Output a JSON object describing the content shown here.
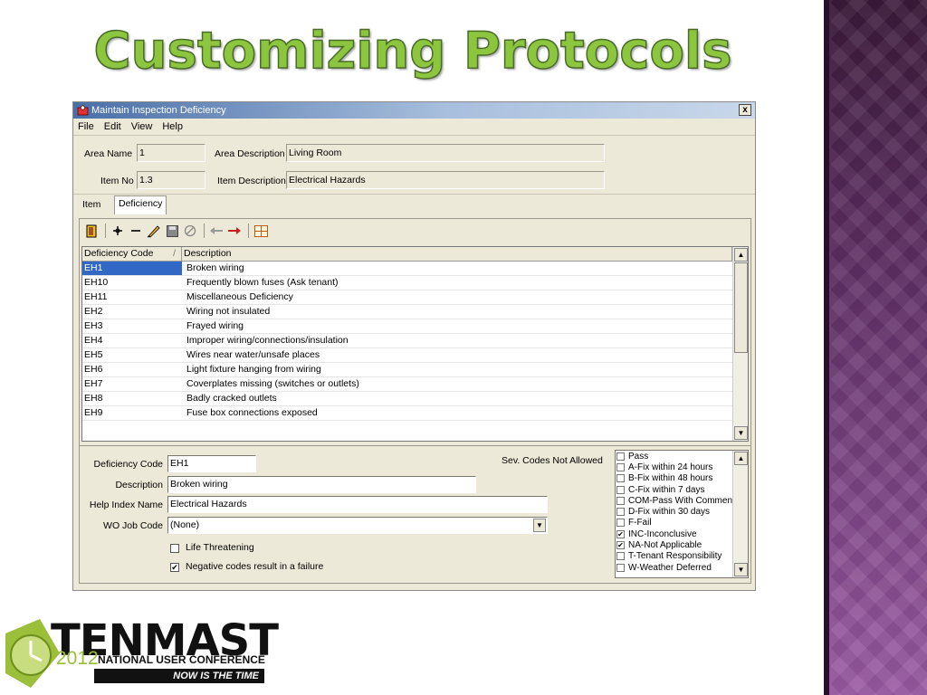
{
  "slide": {
    "title": "Customizing Protocols"
  },
  "window": {
    "title": "Maintain Inspection Deficiency",
    "close_label": "x",
    "menu": [
      "File",
      "Edit",
      "View",
      "Help"
    ]
  },
  "header": {
    "area_name_label": "Area Name",
    "area_name_value": "1",
    "area_description_label": "Area Description",
    "area_description_value": "Living Room",
    "item_no_label": "Item No",
    "item_no_value": "1.3",
    "item_description_label": "Item Description",
    "item_description_value": "Electrical Hazards"
  },
  "tabs": [
    "Item",
    "Deficiency"
  ],
  "active_tab": "Deficiency",
  "toolbar": {
    "icons": [
      "exit-door-icon",
      "add-icon",
      "remove-icon",
      "edit-pen-icon",
      "save-icon",
      "cancel-icon",
      "back-arrow-icon",
      "forward-arrow-icon",
      "grid-layout-icon"
    ]
  },
  "grid": {
    "columns": [
      "Deficiency Code",
      "Description"
    ],
    "sort_indicator": "/",
    "rows": [
      {
        "code": "EH1",
        "description": "Broken wiring"
      },
      {
        "code": "EH10",
        "description": "Frequently blown fuses (Ask tenant)"
      },
      {
        "code": "EH11",
        "description": "Miscellaneous Deficiency"
      },
      {
        "code": "EH2",
        "description": "Wiring not insulated"
      },
      {
        "code": "EH3",
        "description": "Frayed wiring"
      },
      {
        "code": "EH4",
        "description": "Improper wiring/connections/insulation"
      },
      {
        "code": "EH5",
        "description": "Wires near water/unsafe places"
      },
      {
        "code": "EH6",
        "description": "Light fixture hanging from wiring"
      },
      {
        "code": "EH7",
        "description": "Coverplates missing (switches or outlets)"
      },
      {
        "code": "EH8",
        "description": "Badly cracked outlets"
      },
      {
        "code": "EH9",
        "description": "Fuse box connections exposed"
      }
    ],
    "selected_index": 0
  },
  "detail": {
    "deficiency_code_label": "Deficiency Code",
    "deficiency_code_value": "EH1",
    "description_label": "Description",
    "description_value": "Broken wiring",
    "help_index_label": "Help Index Name",
    "help_index_value": "Electrical Hazards",
    "wo_job_code_label": "WO Job Code",
    "wo_job_code_value": "(None)",
    "life_threatening_label": "Life Threatening",
    "life_threatening_checked": false,
    "negative_codes_label": "Negative codes result in a failure",
    "negative_codes_checked": true,
    "sev_codes_label": "Sev. Codes Not Allowed",
    "sev_codes": [
      {
        "label": "Pass",
        "checked": false
      },
      {
        "label": "A-Fix within 24 hours",
        "checked": false
      },
      {
        "label": "B-Fix within 48 hours",
        "checked": false
      },
      {
        "label": "C-Fix within 7 days",
        "checked": false
      },
      {
        "label": "COM-Pass With Comment",
        "checked": false
      },
      {
        "label": "D-Fix within 30 days",
        "checked": false
      },
      {
        "label": "F-Fail",
        "checked": false
      },
      {
        "label": "INC-Inconclusive",
        "checked": true
      },
      {
        "label": "NA-Not Applicable",
        "checked": true
      },
      {
        "label": "T-Tenant Responsibility",
        "checked": false
      },
      {
        "label": "W-Weather Deferred",
        "checked": false
      }
    ]
  },
  "logo": {
    "word": "TENMAST",
    "year": "2012",
    "conference": "NATIONAL USER CONFERENCE",
    "tagline": "NOW IS THE TIME"
  },
  "colors": {
    "title_green": "#8cc63f",
    "selection_blue": "#3168c5",
    "strip_purple": "#7d4585"
  }
}
